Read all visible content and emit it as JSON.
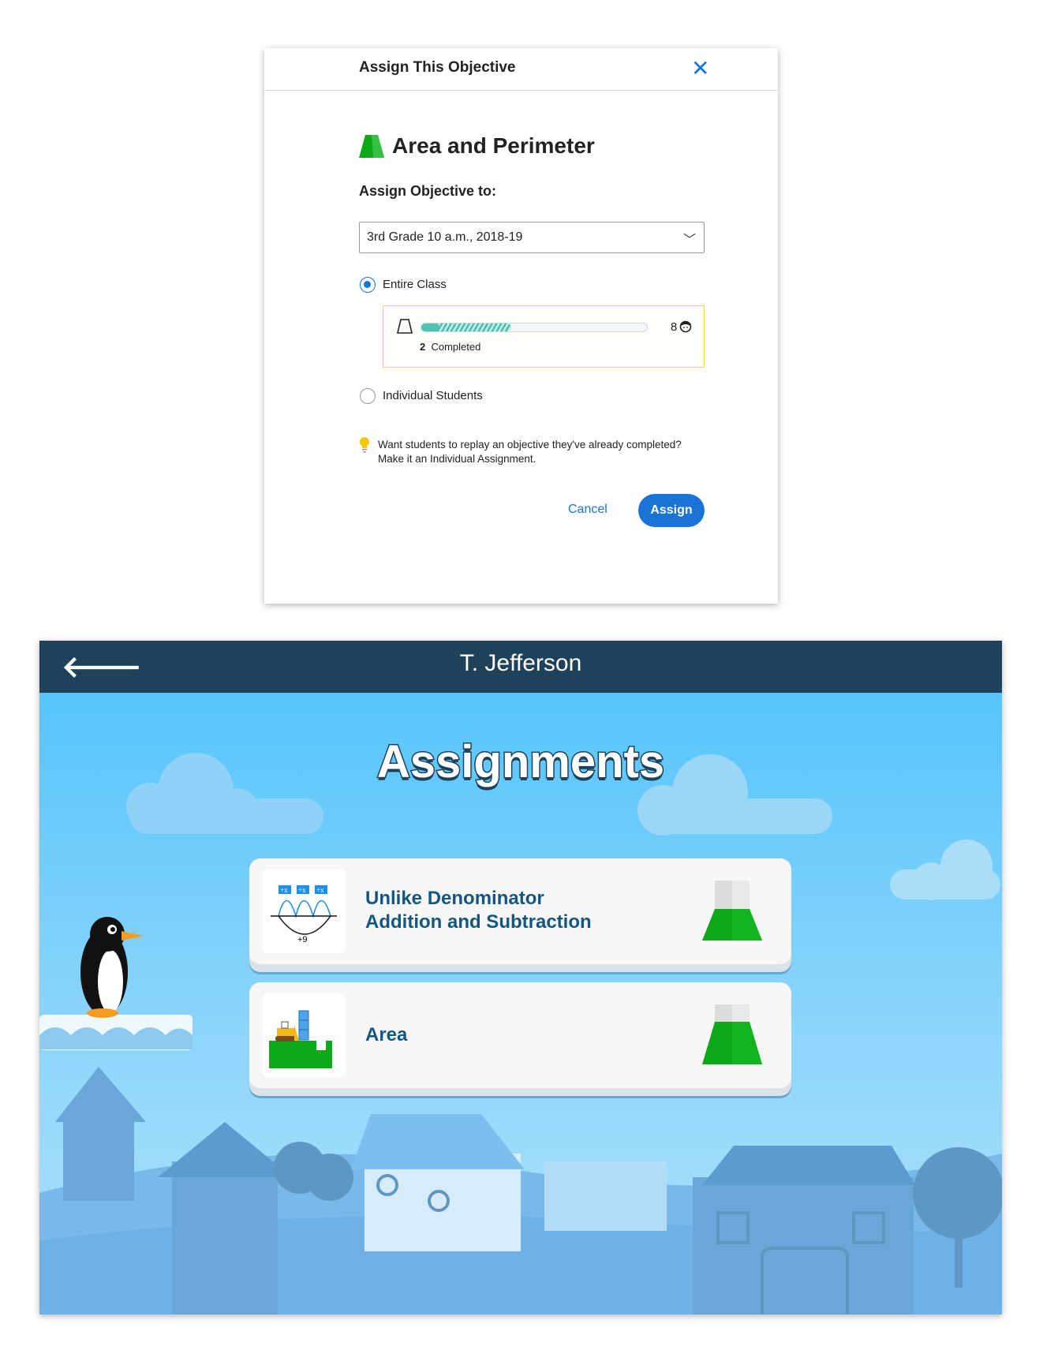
{
  "dialog": {
    "title": "Assign This Objective",
    "close_icon": "close-icon",
    "objective_title": "Area and Perimeter",
    "assign_to_label": "Assign Objective to:",
    "class_select": {
      "value": "3rd Grade 10 a.m., 2018-19"
    },
    "options": [
      {
        "label": "Entire Class",
        "selected": true
      },
      {
        "label": "Individual Students",
        "selected": false
      }
    ],
    "progress": {
      "completed_count": "2",
      "completed_label": "Completed",
      "student_count": "8",
      "completed_fraction": 0.08,
      "in_progress_fraction": 0.4
    },
    "hint_line1": "Want students to replay an objective they've already completed?",
    "hint_line2": "Make it an Individual Assignment.",
    "cancel_label": "Cancel",
    "assign_label": "Assign",
    "colors": {
      "accent": "#1a73d6",
      "progress": "#4ec3b3",
      "box_border": "#f5cf6b"
    }
  },
  "game": {
    "header_title": "T. Jefferson",
    "heading": "Assignments",
    "assignments": [
      {
        "title_line1": "Unlike Denominator",
        "title_line2": "Addition and Subtraction",
        "thumb_label": "+9",
        "thumb_tag": "+x"
      },
      {
        "title_line1": "Area"
      }
    ],
    "colors": {
      "header": "#1d4259",
      "title": "#14567f",
      "flask": "#0da818"
    }
  }
}
